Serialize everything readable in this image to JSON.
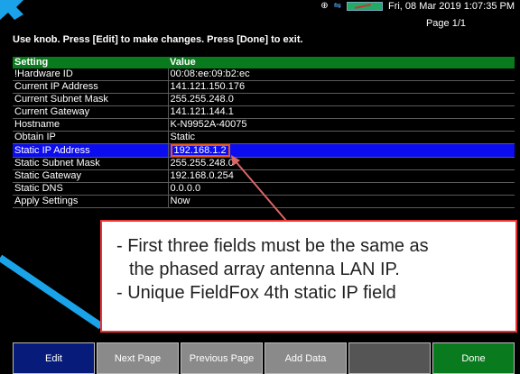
{
  "status_bar": {
    "datetime": "Fri, 08 Mar 2019 1:07:35 PM",
    "icons": [
      "gps-icon",
      "network-icon",
      "battery-icon"
    ]
  },
  "page_info": "Page 1/1",
  "instruction": "Use knob. Press [Edit] to make changes. Press [Done] to exit.",
  "table": {
    "headers": [
      "Setting",
      "Value"
    ],
    "rows": [
      {
        "setting": "!Hardware ID",
        "value": "00:08:ee:09:b2:ec"
      },
      {
        "setting": "Current IP Address",
        "value": "141.121.150.176"
      },
      {
        "setting": "Current Subnet Mask",
        "value": "255.255.248.0"
      },
      {
        "setting": "Current Gateway",
        "value": "141.121.144.1"
      },
      {
        "setting": "Hostname",
        "value": "K-N9952A-40075"
      },
      {
        "setting": "Obtain IP",
        "value": "Static"
      },
      {
        "setting": "Static IP Address",
        "value": "192.168.1.2",
        "selected": true
      },
      {
        "setting": "Static Subnet Mask",
        "value": "255.255.248.0"
      },
      {
        "setting": "Static Gateway",
        "value": "192.168.0.254"
      },
      {
        "setting": "Static DNS",
        "value": "0.0.0.0"
      },
      {
        "setting": "Apply Settings",
        "value": "Now"
      }
    ]
  },
  "callout": {
    "line1": "- First three fields must be the same as",
    "line2": "the phased array antenna LAN IP.",
    "line3": "- Unique FieldFox 4th static IP field"
  },
  "softkeys": [
    "Edit",
    "Next Page",
    "Previous Page",
    "Add Data",
    "",
    "Done"
  ],
  "colors": {
    "header_green": "#0a7a1e",
    "selected_blue": "#0c0cf0",
    "callout_border": "#e33",
    "annotation_arrow": "#1aa3e8"
  }
}
